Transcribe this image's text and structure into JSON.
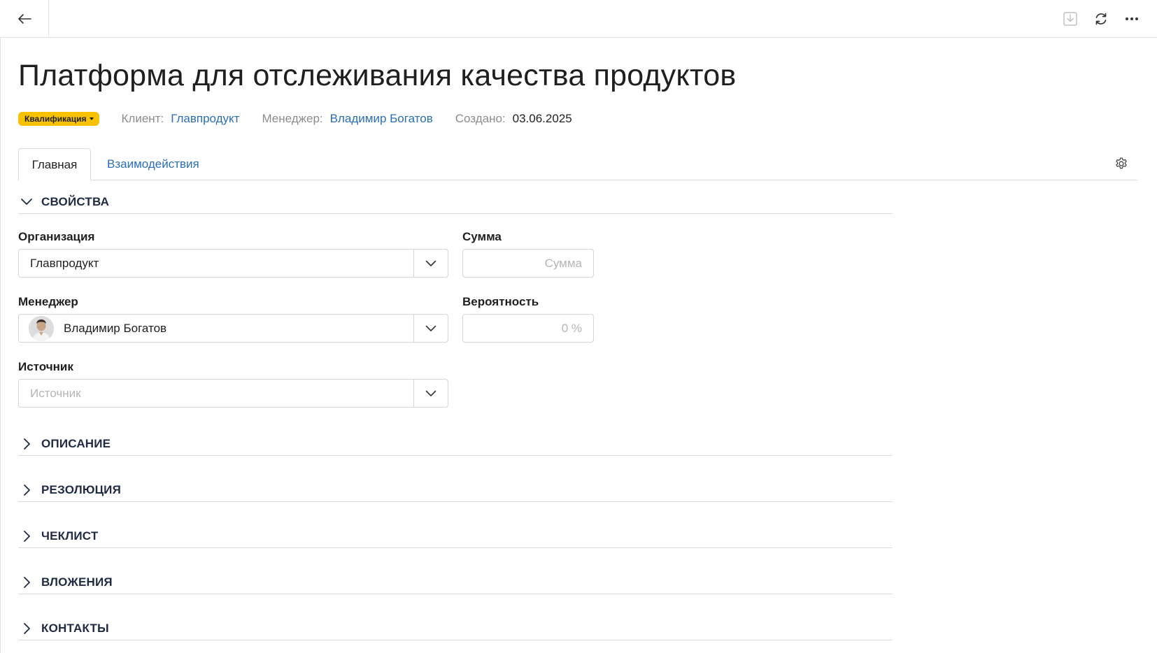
{
  "topbar": {
    "back_icon": "arrow-left-icon",
    "download_icon": "download-icon",
    "refresh_icon": "refresh-icon",
    "more_icon": "more-horizontal-icon"
  },
  "page": {
    "title": "Платформа для отслеживания качества продуктов",
    "stage_badge": "Квалификация",
    "stage_badge_color": "#f9c200",
    "client_label": "Клиент:",
    "client_value": "Главпродукт",
    "manager_label": "Менеджер:",
    "manager_value": "Владимир Богатов",
    "created_label": "Создано:",
    "created_value": "03.06.2025"
  },
  "tabs": [
    {
      "label": "Главная",
      "active": true
    },
    {
      "label": "Взаимодействия",
      "active": false
    }
  ],
  "sections": {
    "properties": "СВОЙСТВА",
    "description": "ОПИСАНИЕ",
    "resolution": "РЕЗОЛЮЦИЯ",
    "checklist": "ЧЕКЛИСТ",
    "attachments": "ВЛОЖЕНИЯ",
    "contacts": "КОНТАКТЫ"
  },
  "fields": {
    "organization": {
      "label": "Организация",
      "value": "Главпродукт"
    },
    "manager": {
      "label": "Менеджер",
      "value": "Владимир Богатов"
    },
    "source": {
      "label": "Источник",
      "placeholder": "Источник"
    },
    "amount": {
      "label": "Сумма",
      "placeholder": "Сумма"
    },
    "probability": {
      "label": "Вероятность",
      "placeholder": "0 %"
    }
  },
  "colors": {
    "accent": "#2a6ebb",
    "badge": "#f9c200",
    "section_title": "#1f2a44"
  }
}
